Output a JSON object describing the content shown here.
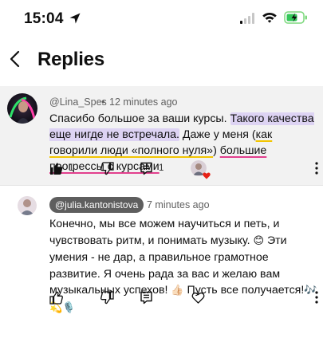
{
  "status_bar": {
    "time": "15:04",
    "icons": [
      "location-arrow-icon",
      "cellular-signal-icon",
      "wifi-icon",
      "battery-charging-icon"
    ]
  },
  "header": {
    "title": "Replies",
    "back_icon": "chevron-left-icon"
  },
  "comment": {
    "author": "@Lina_Spes",
    "separator": "•",
    "time": "12 minutes ago",
    "text_parts": {
      "p1": "Спасибо большое за ваши курсы. ",
      "p2": "Такого качества еще нигде не встречала.",
      "p3": " Даже у меня (",
      "p4": "как говорили люди «полного нуля»",
      "p5": ") ",
      "p6": "большие прогрессы с курсами"
    },
    "highlight_colors": {
      "purple": "#ddd3f3",
      "yellow": "#f2c500",
      "pink": "#e23f8e"
    },
    "like_count": "1",
    "reply_count": "1",
    "hearted_by_creator": true
  },
  "reply": {
    "author": "@julia.kantonistova",
    "separator": "•",
    "time": "7 minutes ago",
    "text_parts": {
      "p1": "Конечно, мы все можем научиться и петь, и чувствовать ритм, и понимать музыку. ",
      "e1": "😊",
      "p2": " Эти умения - не дар, а правильное грамотное развитие. Я очень рада за вас и желаю вам музыкальных  успехов! ",
      "e2": "👍🏻",
      "p3": " Пусть все получается!",
      "e3": "🎶💫🎙️"
    }
  },
  "colors": {
    "comment_background": "#f2f2f2",
    "author_chip_background": "#5e5e5e",
    "heart": "#e62117"
  }
}
